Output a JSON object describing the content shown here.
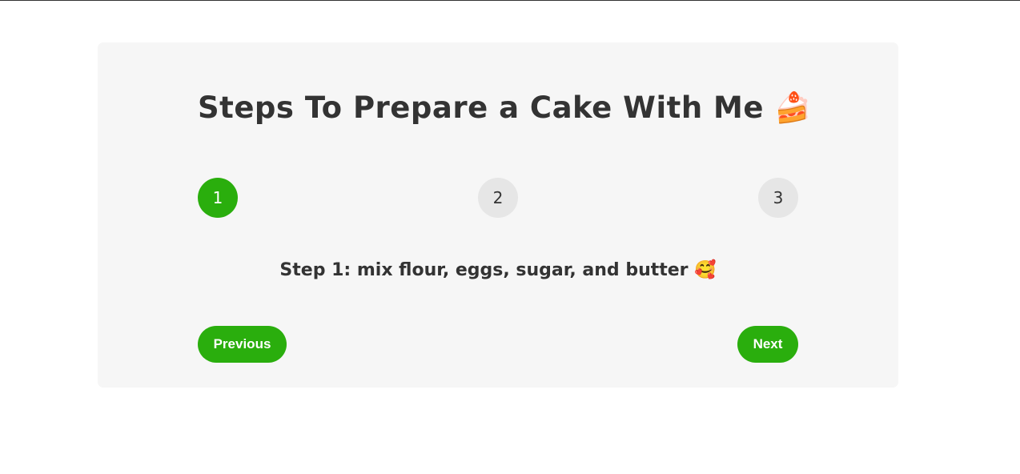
{
  "title": "Steps To Prepare a Cake With Me 🍰",
  "steps": [
    {
      "label": "1",
      "active": true
    },
    {
      "label": "2",
      "active": false
    },
    {
      "label": "3",
      "active": false
    }
  ],
  "current_step_text": "Step 1: mix flour, eggs, sugar, and butter 🥰",
  "buttons": {
    "previous_label": "Previous",
    "next_label": "Next"
  },
  "colors": {
    "accent": "#2aae0d",
    "card_background": "#f6f6f6",
    "inactive_step": "#e6e6e6",
    "text": "#333333"
  }
}
